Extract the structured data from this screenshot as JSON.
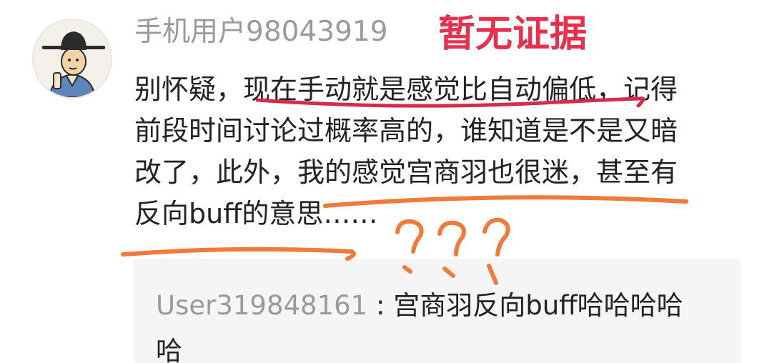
{
  "comment": {
    "username": "手机用户98043919",
    "annotation": "暂无证据",
    "lines": [
      "别怀疑，现在手动就是感觉比自动偏低，记得",
      "前段时间讨论过概率高的，谁知道是不是又暗",
      "改了，此外，我的感觉宫商羽也很迷，甚至有",
      "反向buff的意思……"
    ]
  },
  "reply": {
    "user": "User319848161",
    "separator": " : ",
    "lines": [
      "宫商羽反向buff哈哈哈哈",
      "哈"
    ]
  },
  "colors": {
    "annotation_red": "#e8304c",
    "underline_red": "#d62b48",
    "underline_orange": "#f07a3a",
    "username_gray": "#9a9a9a"
  },
  "icons": {
    "avatar": "official-hat-scholar-avatar"
  }
}
